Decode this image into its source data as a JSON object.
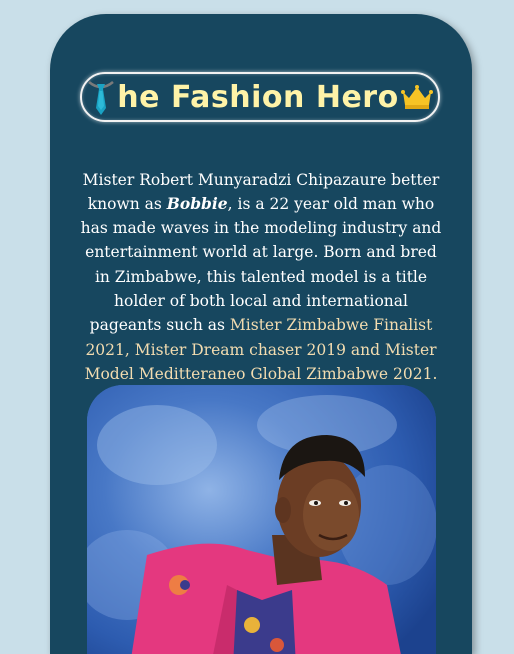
{
  "header": {
    "title": "he Fashion Hero",
    "left_icon": "tie-icon",
    "right_icon": "crown-icon",
    "title_color": "#fff3a8"
  },
  "intro": {
    "part1": "Mister Robert Munyaradzi Chipazaure better known as ",
    "nickname": "Bobbie",
    "part2": ", is a 22 year old man who has made waves in the modeling industry and entertainment world at large. Born and bred in Zimbabwe, this talented model is a title holder of both local and international pageants such as ",
    "titles": "Mister Zimbabwe Finalist 2021, Mister Dream chaser 2019 and Mister Model Meditteraneo Global Zimbabwe 2021."
  },
  "photo": {
    "subject": "portrait-photo",
    "background_color": "#3a6fc0",
    "jacket_color": "#e4387f"
  },
  "colors": {
    "page_bg": "#c9dfe9",
    "card_bg": "#17475f",
    "titles_highlight": "#f2dcb0"
  }
}
